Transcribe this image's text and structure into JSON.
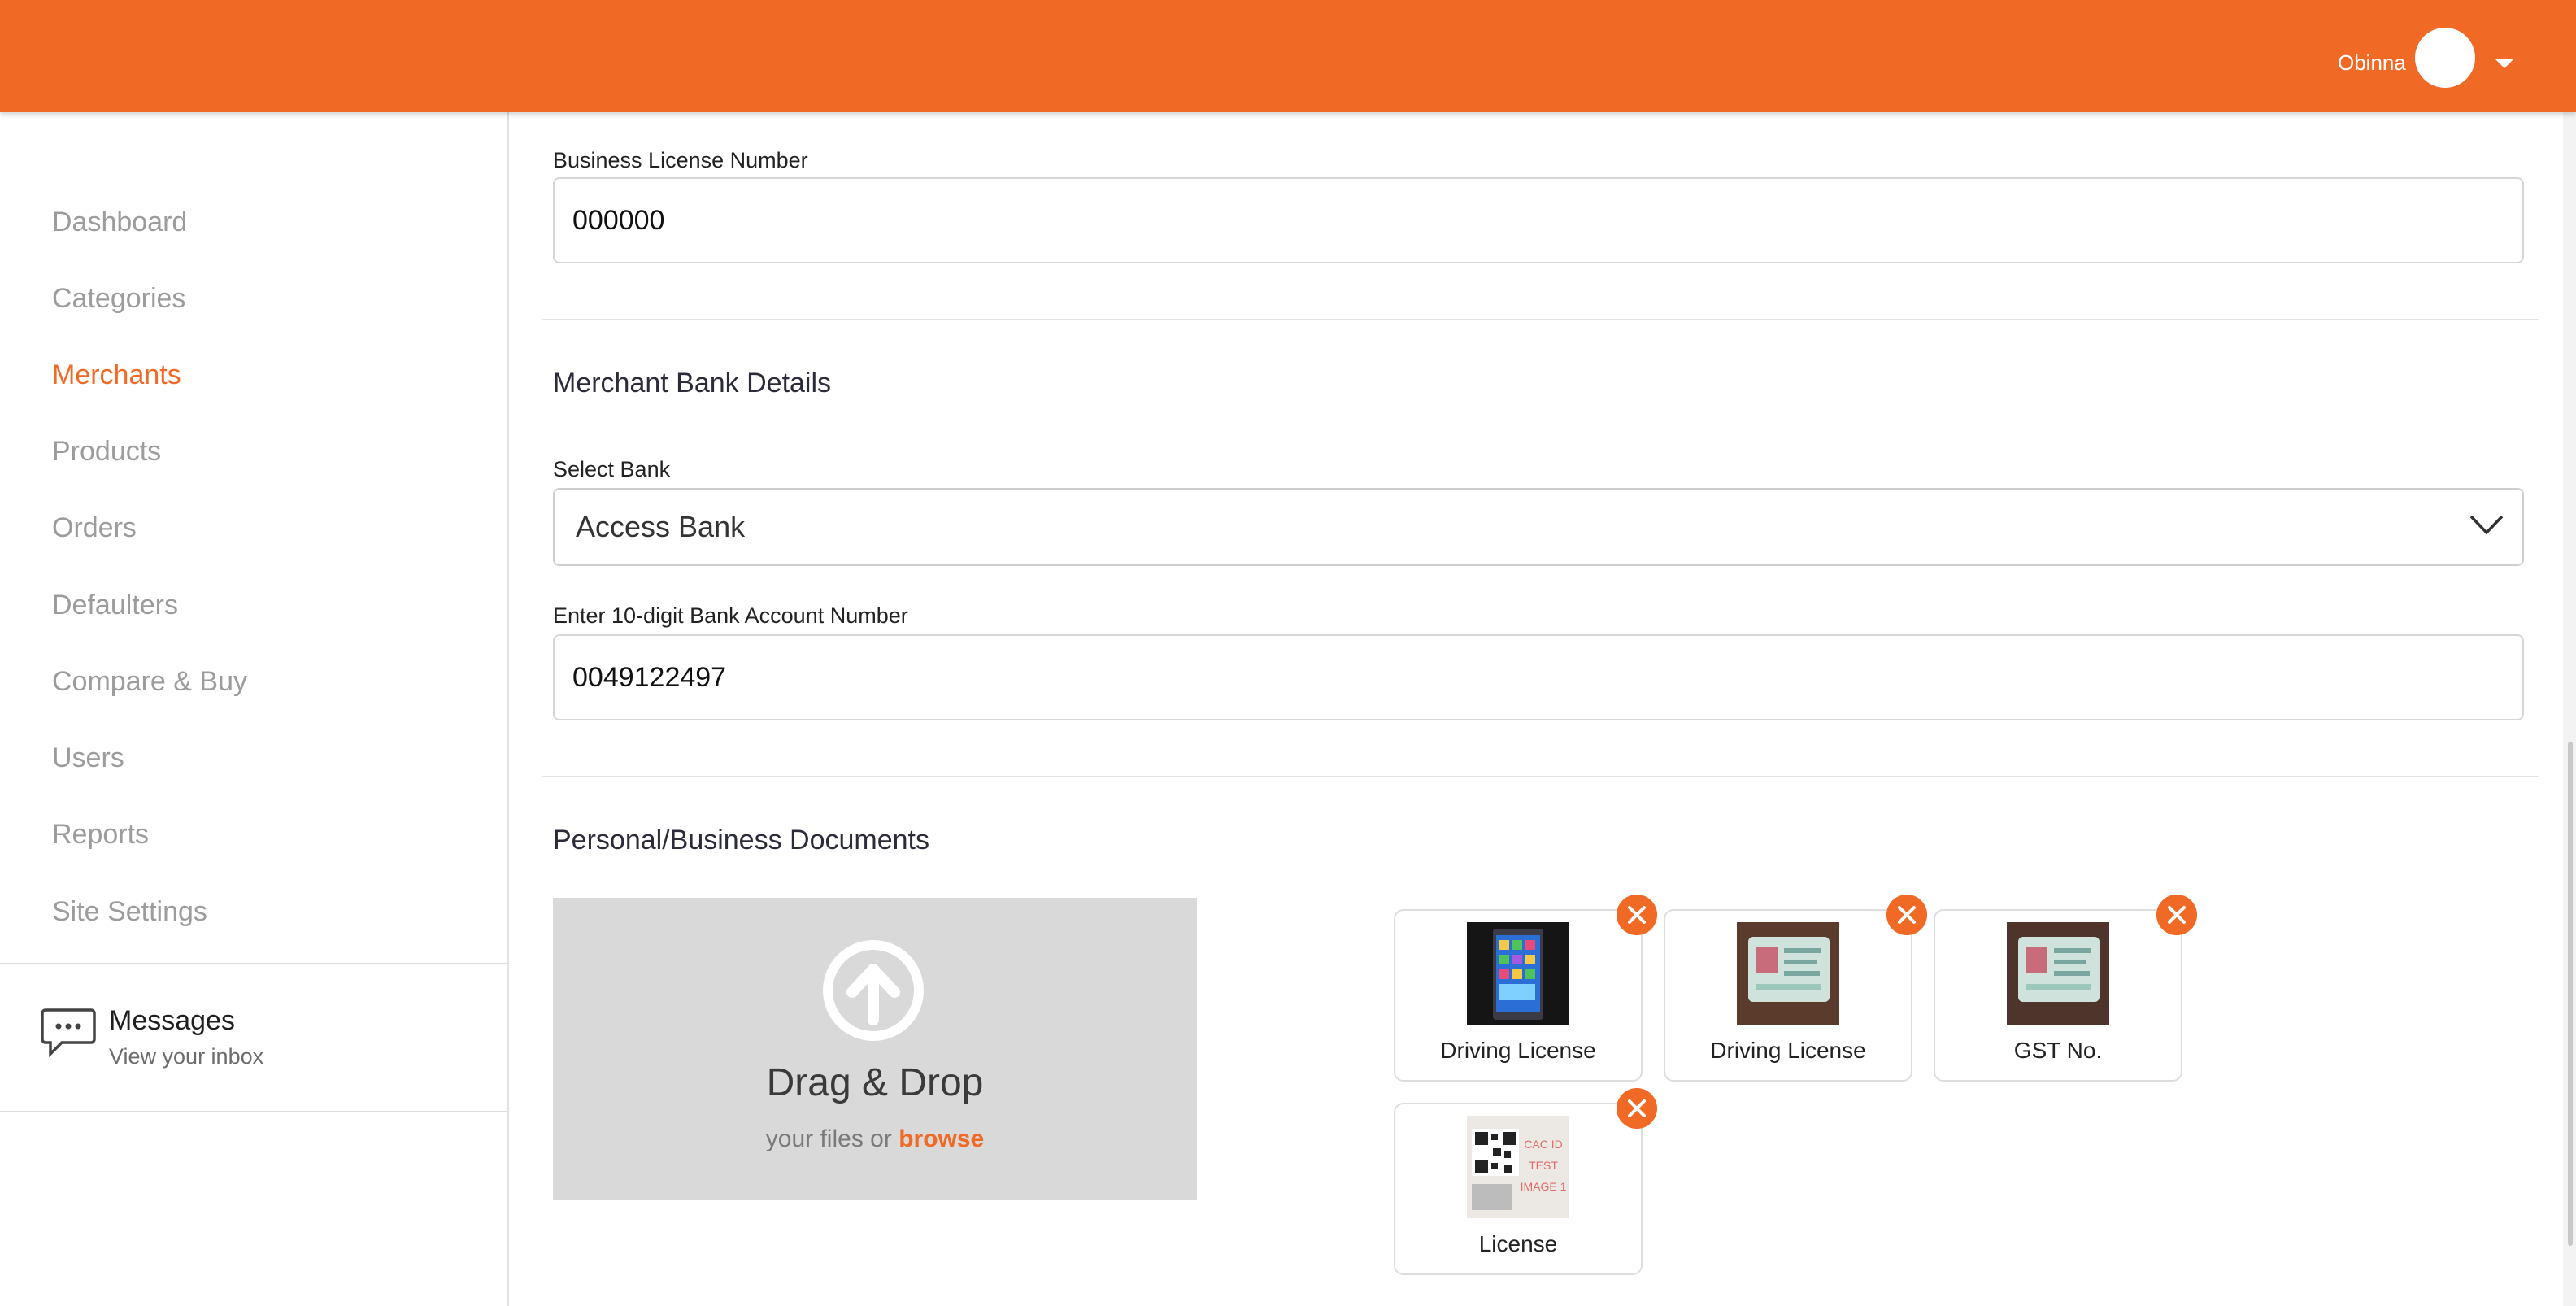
{
  "colors": {
    "accent": "#f06a26",
    "sidebar_text": "#9c9c9c",
    "dropzone_bg": "#d9d9d9"
  },
  "header": {
    "user_name": "Obinna"
  },
  "sidebar": {
    "items": [
      {
        "label": "Dashboard"
      },
      {
        "label": "Categories"
      },
      {
        "label": "Merchants",
        "active": true
      },
      {
        "label": "Products"
      },
      {
        "label": "Orders"
      },
      {
        "label": "Defaulters"
      },
      {
        "label": "Compare & Buy"
      },
      {
        "label": "Users"
      },
      {
        "label": "Reports"
      },
      {
        "label": "Site Settings"
      }
    ],
    "messages": {
      "title": "Messages",
      "subtitle": "View your inbox",
      "icon": "chat-bubble-icon"
    }
  },
  "form": {
    "business_license": {
      "label": "Business License Number",
      "value": "000000"
    },
    "bank_section_title": "Merchant Bank Details",
    "bank": {
      "label": "Select Bank",
      "value": "Access Bank"
    },
    "account": {
      "label": "Enter 10-digit Bank Account Number",
      "value": "0049122497"
    },
    "documents_section_title": "Personal/Business Documents"
  },
  "dropzone": {
    "title": "Drag & Drop",
    "sub_prefix": "your files or",
    "browse": "browse",
    "icon": "upload-arrow-icon"
  },
  "documents": [
    {
      "label": "Driving License",
      "thumb": "phone-screenshot"
    },
    {
      "label": "Driving License",
      "thumb": "id-card-photo"
    },
    {
      "label": "GST No.",
      "thumb": "id-card-photo"
    },
    {
      "label": "License",
      "thumb": "qr-code-image",
      "thumb_text": [
        "CAC ID",
        "TEST",
        "IMAGE 1"
      ]
    }
  ]
}
